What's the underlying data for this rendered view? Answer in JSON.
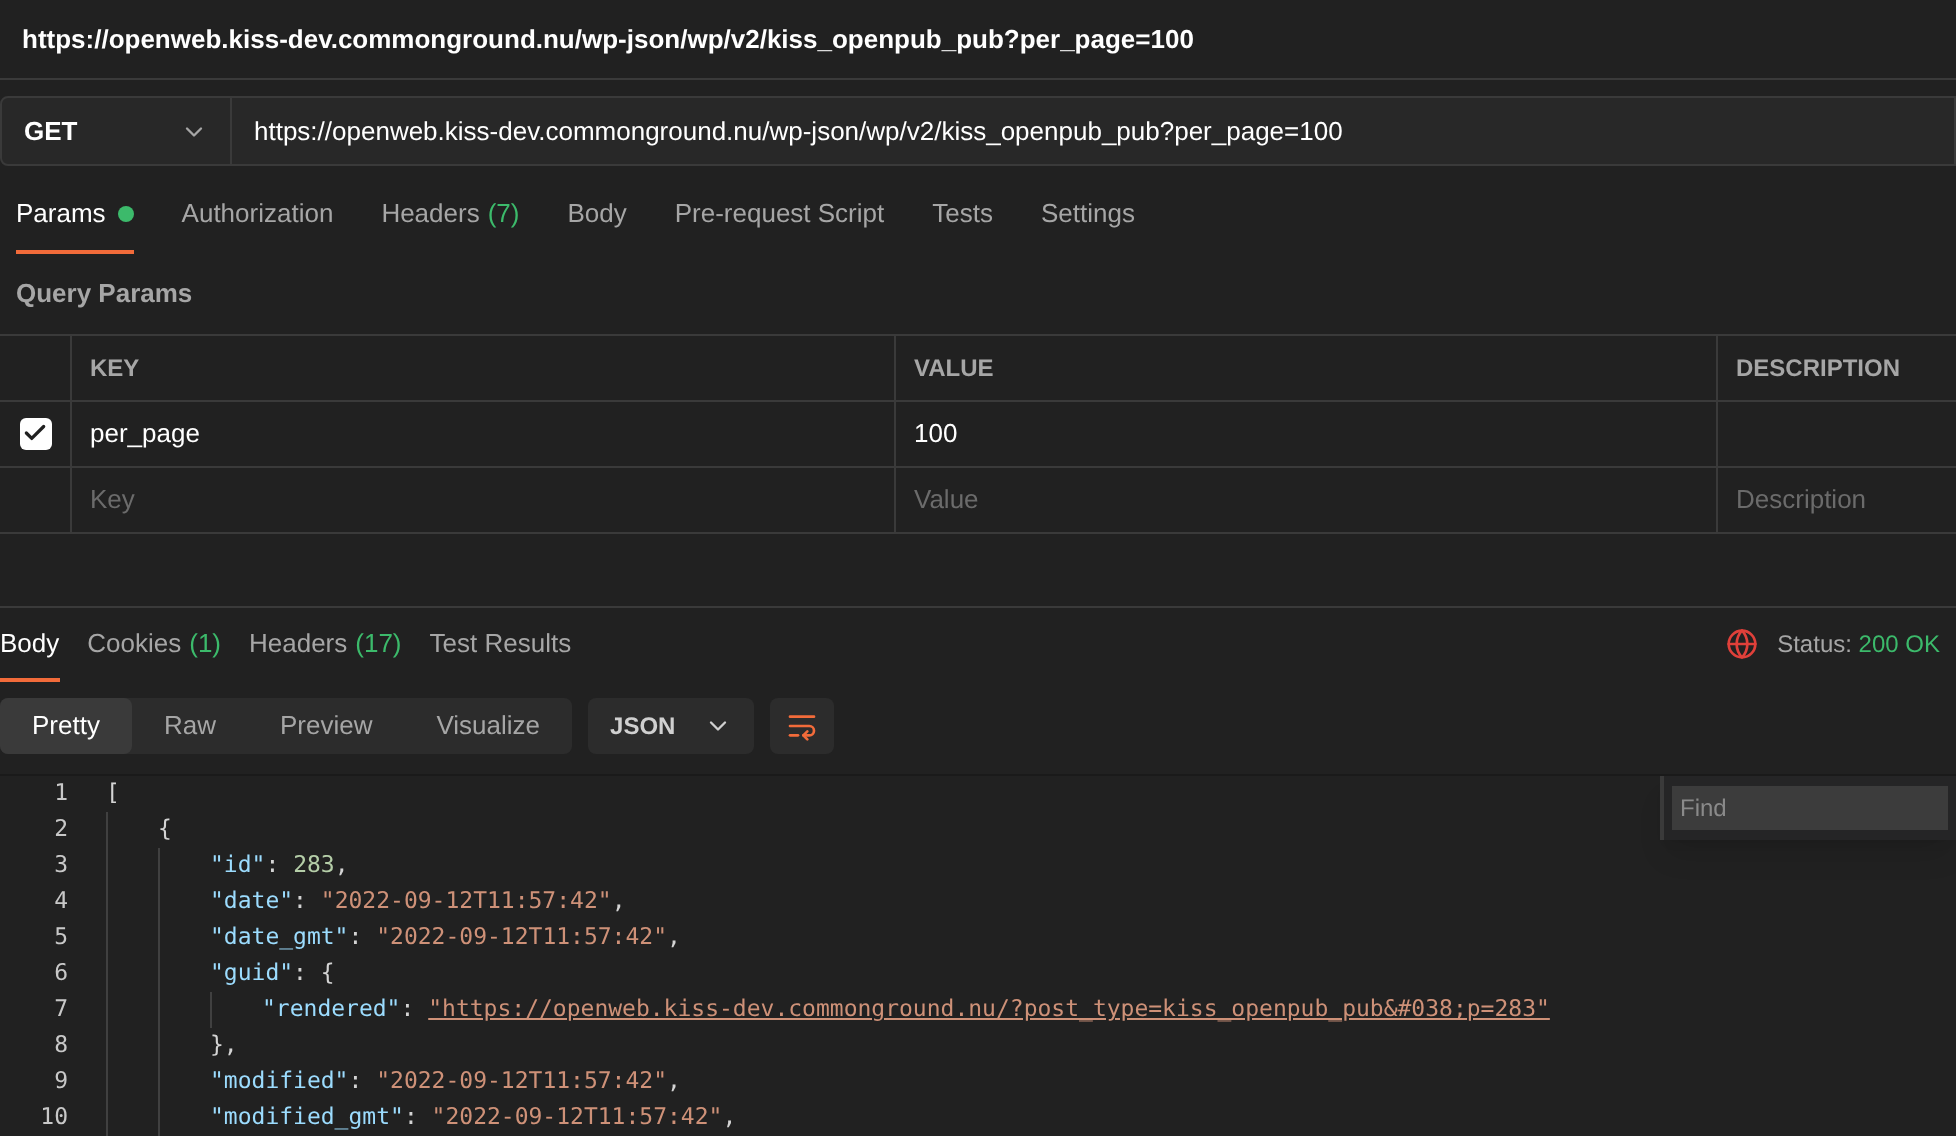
{
  "title": "https://openweb.kiss-dev.commonground.nu/wp-json/wp/v2/kiss_openpub_pub?per_page=100",
  "request": {
    "method": "GET",
    "url": "https://openweb.kiss-dev.commonground.nu/wp-json/wp/v2/kiss_openpub_pub?per_page=100"
  },
  "request_tabs": [
    {
      "label": "Params",
      "selected": true,
      "dot": true
    },
    {
      "label": "Authorization",
      "selected": false
    },
    {
      "label": "Headers",
      "count": "(7)",
      "selected": false
    },
    {
      "label": "Body",
      "selected": false
    },
    {
      "label": "Pre-request Script",
      "selected": false
    },
    {
      "label": "Tests",
      "selected": false
    },
    {
      "label": "Settings",
      "selected": false
    }
  ],
  "query_params": {
    "heading": "Query Params",
    "columns": [
      "KEY",
      "VALUE",
      "DESCRIPTION"
    ],
    "rows": [
      {
        "checked": true,
        "key": "per_page",
        "value": "100"
      }
    ],
    "new_row": {
      "key_placeholder": "Key",
      "value_placeholder": "Value",
      "description_placeholder": "Description"
    }
  },
  "response_tabs": [
    {
      "label": "Body",
      "selected": true
    },
    {
      "label": "Cookies",
      "count": "(1)",
      "selected": false
    },
    {
      "label": "Headers",
      "count": "(17)",
      "selected": false
    },
    {
      "label": "Test Results",
      "selected": false
    }
  ],
  "status": {
    "label": "Status:",
    "value": "200 OK"
  },
  "view_modes": [
    {
      "label": "Pretty",
      "selected": true
    },
    {
      "label": "Raw",
      "selected": false
    },
    {
      "label": "Preview",
      "selected": false
    },
    {
      "label": "Visualize",
      "selected": false
    }
  ],
  "format": "JSON",
  "find": {
    "placeholder": "Find"
  },
  "code": [
    {
      "number": "1",
      "tokens": [
        {
          "kind": "punct",
          "text": "["
        }
      ],
      "children": [
        {
          "number": "2",
          "tokens": [
            {
              "kind": "punct",
              "text": "{"
            }
          ],
          "children": [
            {
              "number": "3",
              "tokens": [
                {
                  "kind": "key",
                  "text": "\"id\""
                },
                {
                  "kind": "punct",
                  "text": ": "
                },
                {
                  "kind": "number",
                  "text": "283"
                },
                {
                  "kind": "punct",
                  "text": ","
                }
              ]
            },
            {
              "number": "4",
              "tokens": [
                {
                  "kind": "key",
                  "text": "\"date\""
                },
                {
                  "kind": "punct",
                  "text": ": "
                },
                {
                  "kind": "string",
                  "text": "\"2022-09-12T11:57:42\""
                },
                {
                  "kind": "punct",
                  "text": ","
                }
              ]
            },
            {
              "number": "5",
              "tokens": [
                {
                  "kind": "key",
                  "text": "\"date_gmt\""
                },
                {
                  "kind": "punct",
                  "text": ": "
                },
                {
                  "kind": "string",
                  "text": "\"2022-09-12T11:57:42\""
                },
                {
                  "kind": "punct",
                  "text": ","
                }
              ]
            },
            {
              "number": "6",
              "tokens": [
                {
                  "kind": "key",
                  "text": "\"guid\""
                },
                {
                  "kind": "punct",
                  "text": ": {"
                }
              ],
              "children": [
                {
                  "number": "7",
                  "tokens": [
                    {
                      "kind": "key",
                      "text": "\"rendered\""
                    },
                    {
                      "kind": "punct",
                      "text": ": "
                    },
                    {
                      "kind": "link",
                      "text": "\"https://openweb.kiss-dev.commonground.nu/?post_type=kiss_openpub_pub&#038;p=283\""
                    }
                  ]
                }
              ]
            },
            {
              "number": "8",
              "tokens": [
                {
                  "kind": "punct",
                  "text": "},"
                }
              ]
            },
            {
              "number": "9",
              "tokens": [
                {
                  "kind": "key",
                  "text": "\"modified\""
                },
                {
                  "kind": "punct",
                  "text": ": "
                },
                {
                  "kind": "string",
                  "text": "\"2022-09-12T11:57:42\""
                },
                {
                  "kind": "punct",
                  "text": ","
                }
              ]
            },
            {
              "number": "10",
              "tokens": [
                {
                  "kind": "key",
                  "text": "\"modified_gmt\""
                },
                {
                  "kind": "punct",
                  "text": ": "
                },
                {
                  "kind": "string",
                  "text": "\"2022-09-12T11:57:42\""
                },
                {
                  "kind": "punct",
                  "text": ","
                }
              ]
            }
          ]
        }
      ]
    }
  ]
}
